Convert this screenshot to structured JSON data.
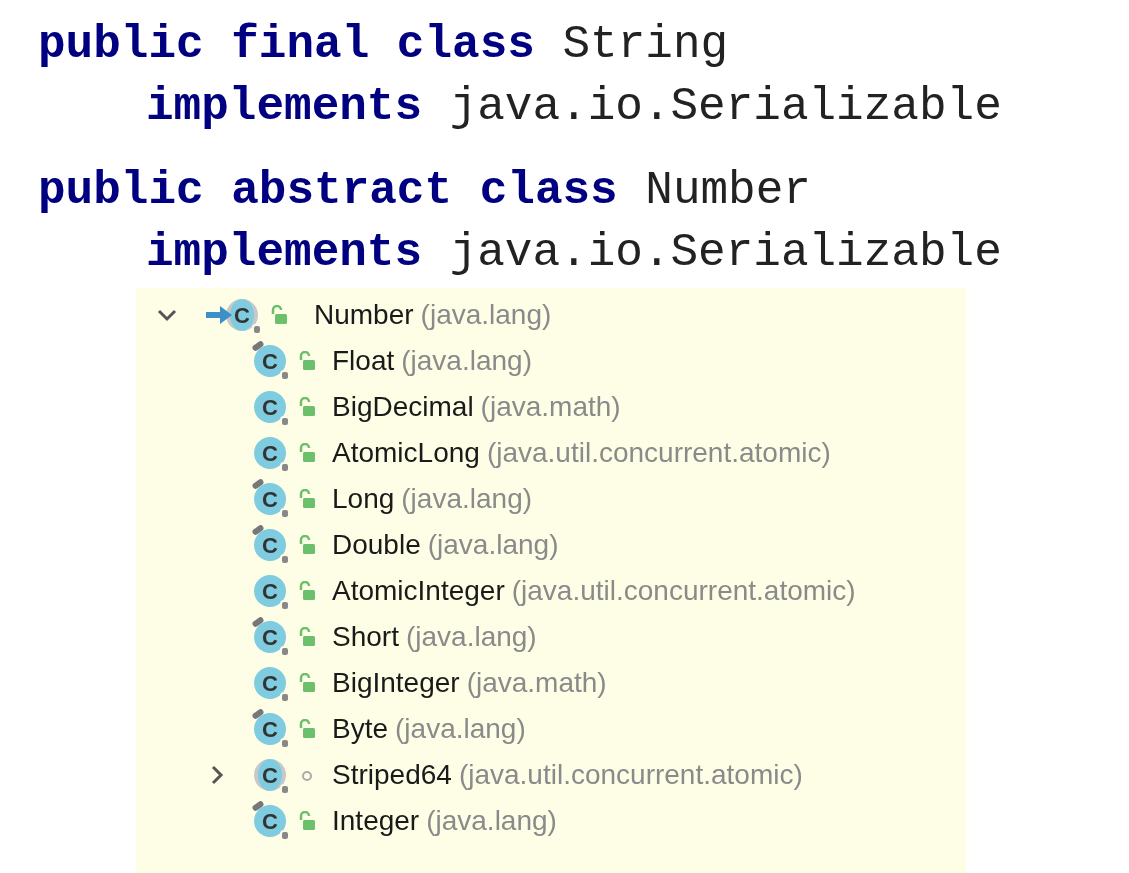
{
  "code_lines": [
    {
      "text": "**public final class** String",
      "indent": false
    },
    {
      "text": "**implements** java.io.Serializable",
      "indent": true
    },
    {
      "text": "**public abstract class** Number",
      "indent": false
    },
    {
      "text": "**implements** java.io.Serializable",
      "indent": true
    }
  ],
  "hierarchy": {
    "root": {
      "name": "Number",
      "package": "(java.lang)",
      "icon_letter": "C",
      "expanded": true,
      "current": true,
      "abstract": true,
      "final": false,
      "public": true,
      "children": [
        {
          "name": "Float",
          "package": "(java.lang)",
          "icon_letter": "C",
          "final": true,
          "abstract": false,
          "public": true
        },
        {
          "name": "BigDecimal",
          "package": "(java.math)",
          "icon_letter": "C",
          "final": false,
          "abstract": false,
          "public": true
        },
        {
          "name": "AtomicLong",
          "package": "(java.util.concurrent.atomic)",
          "icon_letter": "C",
          "final": false,
          "abstract": false,
          "public": true
        },
        {
          "name": "Long",
          "package": "(java.lang)",
          "icon_letter": "C",
          "final": true,
          "abstract": false,
          "public": true
        },
        {
          "name": "Double",
          "package": "(java.lang)",
          "icon_letter": "C",
          "final": true,
          "abstract": false,
          "public": true
        },
        {
          "name": "AtomicInteger",
          "package": "(java.util.concurrent.atomic)",
          "icon_letter": "C",
          "final": false,
          "abstract": false,
          "public": true
        },
        {
          "name": "Short",
          "package": "(java.lang)",
          "icon_letter": "C",
          "final": true,
          "abstract": false,
          "public": true
        },
        {
          "name": "BigInteger",
          "package": "(java.math)",
          "icon_letter": "C",
          "final": false,
          "abstract": false,
          "public": true
        },
        {
          "name": "Byte",
          "package": "(java.lang)",
          "icon_letter": "C",
          "final": true,
          "abstract": false,
          "public": true
        },
        {
          "name": "Striped64",
          "package": "(java.util.concurrent.atomic)",
          "icon_letter": "C",
          "final": false,
          "abstract": true,
          "public": false,
          "expanded": false
        },
        {
          "name": "Integer",
          "package": "(java.lang)",
          "icon_letter": "C",
          "final": true,
          "abstract": false,
          "public": true
        }
      ]
    }
  }
}
